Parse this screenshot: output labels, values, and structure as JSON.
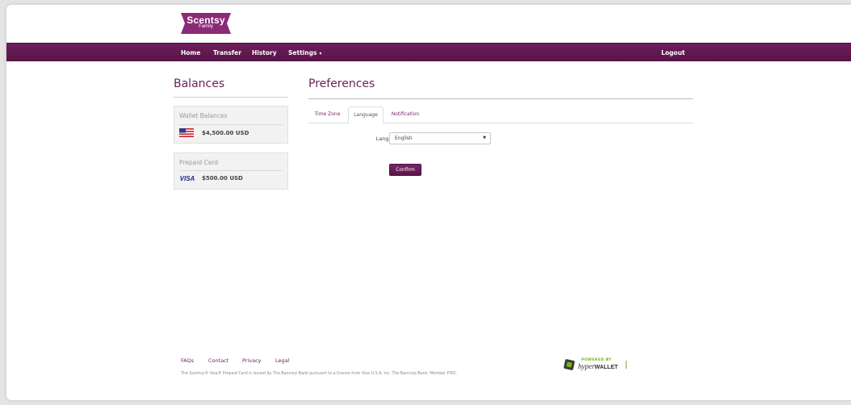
{
  "brand": {
    "name": "Scentsy",
    "sub": "Family",
    "logo_color": "#8b2a77"
  },
  "nav": {
    "items": [
      "Home",
      "Transfer",
      "History",
      "Settings"
    ],
    "logout": "Logout",
    "bar_color": "#5e1a4f",
    "settings_caret": "▾"
  },
  "sidebar": {
    "title": "Balances",
    "wallet": {
      "title": "Wallet Balances",
      "amount": "$4,500.00 USD",
      "icon": "us-flag-icon"
    },
    "prepaid": {
      "title": "Prepaid Card",
      "amount": "$500.00 USD",
      "icon": "visa-icon",
      "visa_label": "VISA"
    }
  },
  "main": {
    "title": "Preferences",
    "tabs": [
      {
        "label": "Time Zone",
        "active": false
      },
      {
        "label": "Language",
        "active": true
      },
      {
        "label": "Notification",
        "active": false
      }
    ],
    "language_label": "Language:",
    "language_value": "English",
    "confirm_label": "Confirm"
  },
  "footer": {
    "links": [
      "FAQs",
      "Contact",
      "Privacy",
      "Legal"
    ],
    "note": "The Scentsy® Visa® Prepaid Card is issued by The Bancorp Bank pursuant to a license from Visa U.S.A. Inc. The Bancorp Bank; Member FDIC.",
    "powered_by": "POWERED BY",
    "hw_brand": "hyper",
    "hw_brand_bold": "WALLET"
  },
  "colors": {
    "accent": "#6b1f5c",
    "background": "#e4e4e4"
  }
}
